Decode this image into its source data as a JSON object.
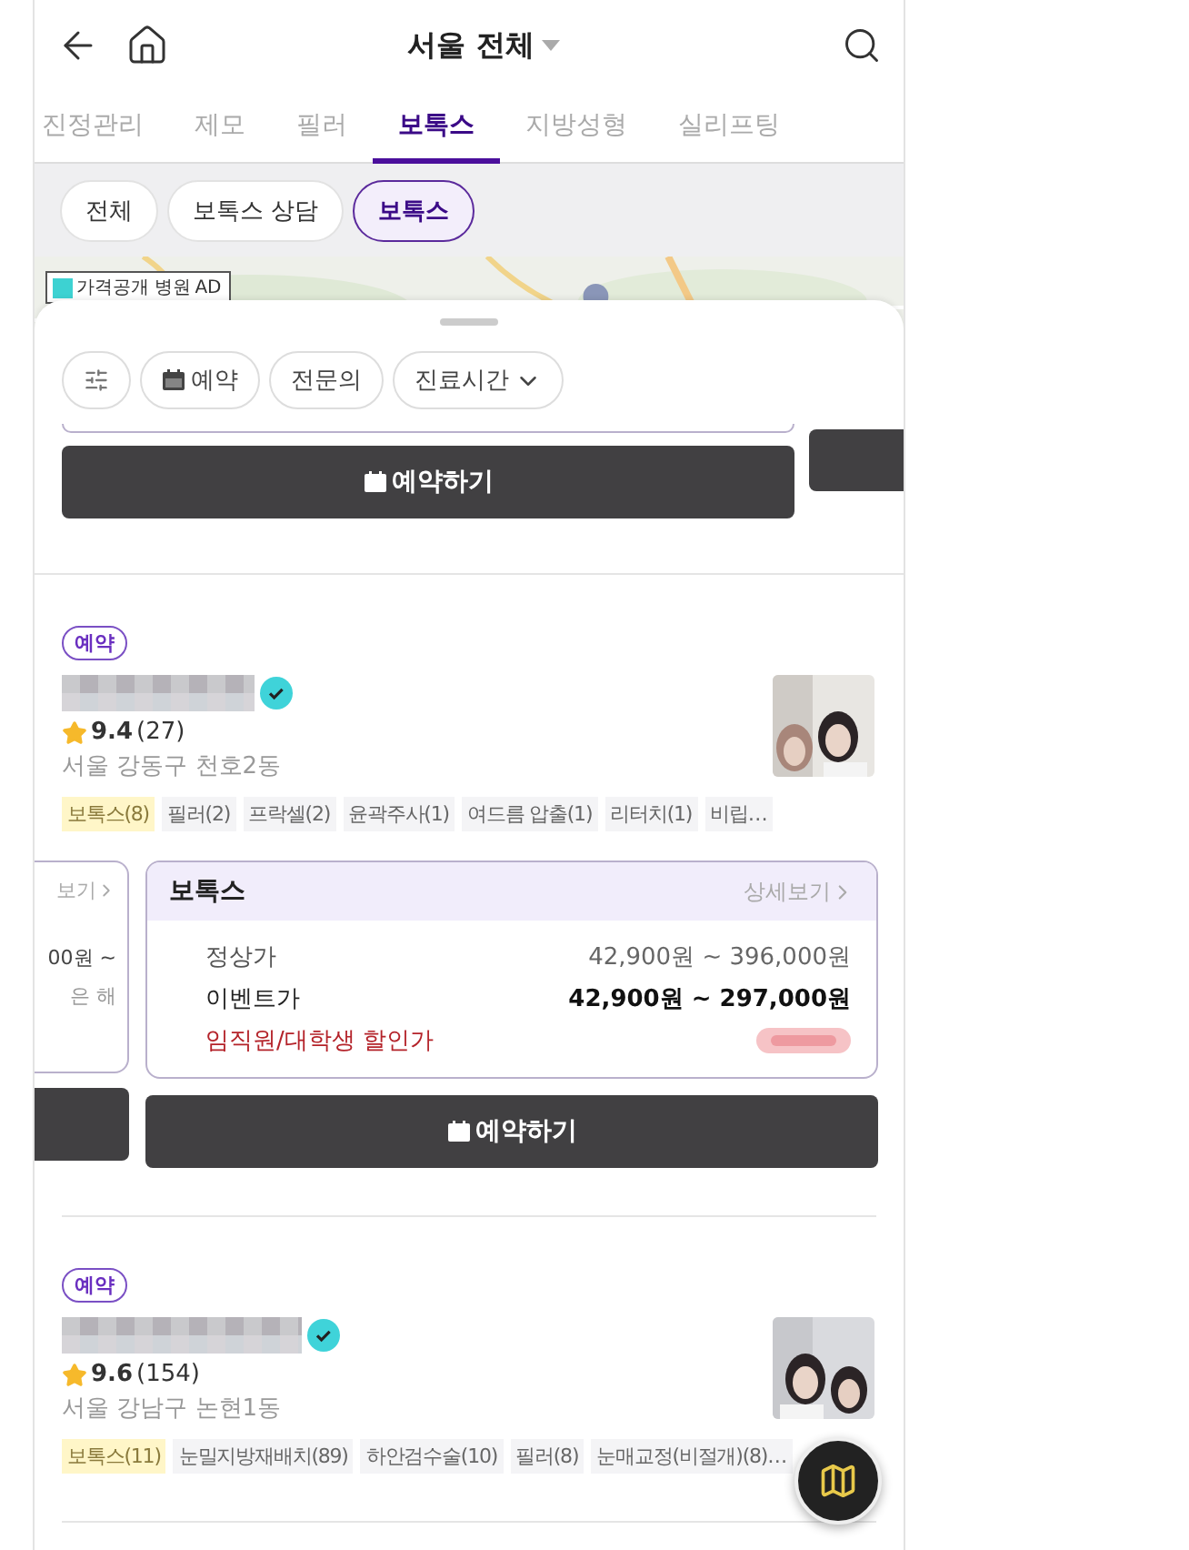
{
  "header": {
    "title": "서울 전체"
  },
  "tabs": [
    {
      "label": "진정관리",
      "selected": false
    },
    {
      "label": "제모",
      "selected": false
    },
    {
      "label": "필러",
      "selected": false
    },
    {
      "label": "보톡스",
      "selected": true
    },
    {
      "label": "지방성형",
      "selected": false
    },
    {
      "label": "실리프팅",
      "selected": false
    }
  ],
  "chips": [
    {
      "label": "전체",
      "selected": false
    },
    {
      "label": "보톡스 상담",
      "selected": false
    },
    {
      "label": "보톡스",
      "selected": true
    }
  ],
  "map": {
    "legend": "가격공개 병원",
    "legend_tag": "AD"
  },
  "filters": [
    {
      "kind": "icon"
    },
    {
      "kind": "calendar",
      "label": "예약"
    },
    {
      "kind": "text",
      "label": "전문의"
    },
    {
      "kind": "dropdown",
      "label": "진료시간"
    }
  ],
  "top_button": "예약하기",
  "clinics": [
    {
      "badge": "예약",
      "rating": "9.4",
      "reviews": "(27)",
      "address": "서울 강동구 천호2동",
      "tags": [
        {
          "label": "보톡스(8)",
          "highlighted": true
        },
        {
          "label": "필러(2)",
          "highlighted": false
        },
        {
          "label": "프락셀(2)",
          "highlighted": false
        },
        {
          "label": "윤곽주사(1)",
          "highlighted": false
        },
        {
          "label": "여드름 압출(1)",
          "highlighted": false
        },
        {
          "label": "리터치(1)",
          "highlighted": false
        },
        {
          "label": "비립…",
          "highlighted": false
        }
      ],
      "prev_card": {
        "link": "보기",
        "price": "00원 ~",
        "note": "은 해"
      },
      "price_card": {
        "title": "보톡스",
        "link": "상세보기",
        "rows": [
          {
            "kind": "regular",
            "label": "정상가",
            "value": "42,900원 ~ 396,000원"
          },
          {
            "kind": "event",
            "label": "이벤트가",
            "value": "42,900원 ~ 297,000원"
          },
          {
            "kind": "discount",
            "label": "임직원/대학생 할인가"
          }
        ]
      },
      "button": "예약하기"
    },
    {
      "badge": "예약",
      "rating": "9.6",
      "reviews": "(154)",
      "address": "서울 강남구 논현1동",
      "tags": [
        {
          "label": "보톡스(11)",
          "highlighted": true
        },
        {
          "label": "눈밀지방재배치(89)",
          "highlighted": false
        },
        {
          "label": "하안검수술(10)",
          "highlighted": false
        },
        {
          "label": "필러(8)",
          "highlighted": false
        },
        {
          "label": "눈매교정(비절개)(8)…",
          "highlighted": false
        }
      ]
    }
  ]
}
